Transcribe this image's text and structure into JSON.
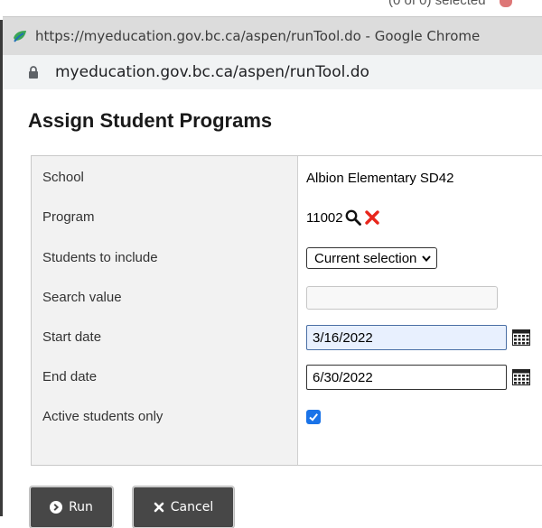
{
  "background": {
    "partial_text": "(0 of 0) selected"
  },
  "window": {
    "title": "https://myeducation.gov.bc.ca/aspen/runTool.do - Google Chrome",
    "address": "myeducation.gov.bc.ca/aspen/runTool.do"
  },
  "dialog": {
    "title": "Assign Student Programs",
    "fields": {
      "school": {
        "label": "School",
        "value": "Albion Elementary SD42"
      },
      "program": {
        "label": "Program",
        "value": "11002"
      },
      "students_to_include": {
        "label": "Students to include",
        "value": "Current selection"
      },
      "search_value": {
        "label": "Search value",
        "value": ""
      },
      "start_date": {
        "label": "Start date",
        "value": "3/16/2022"
      },
      "end_date": {
        "label": "End date",
        "value": "6/30/2022"
      },
      "active_students_only": {
        "label": "Active students only",
        "checked": true
      }
    },
    "buttons": {
      "run": "Run",
      "cancel": "Cancel"
    }
  },
  "colors": {
    "titlebar": "#dcdcdc",
    "addressbar": "#f1f3f4",
    "label_column": "#f2f2f2",
    "button": "#474747",
    "clear_icon": "#e8261c",
    "checkbox": "#1a73e8",
    "focused_input": "#e8f0fe"
  },
  "icons": [
    "favicon-icon",
    "lock-icon",
    "search-icon",
    "clear-icon",
    "chevron-down-icon",
    "calendar-icon",
    "checkmark-icon",
    "run-arrow-icon",
    "cancel-x-icon"
  ]
}
